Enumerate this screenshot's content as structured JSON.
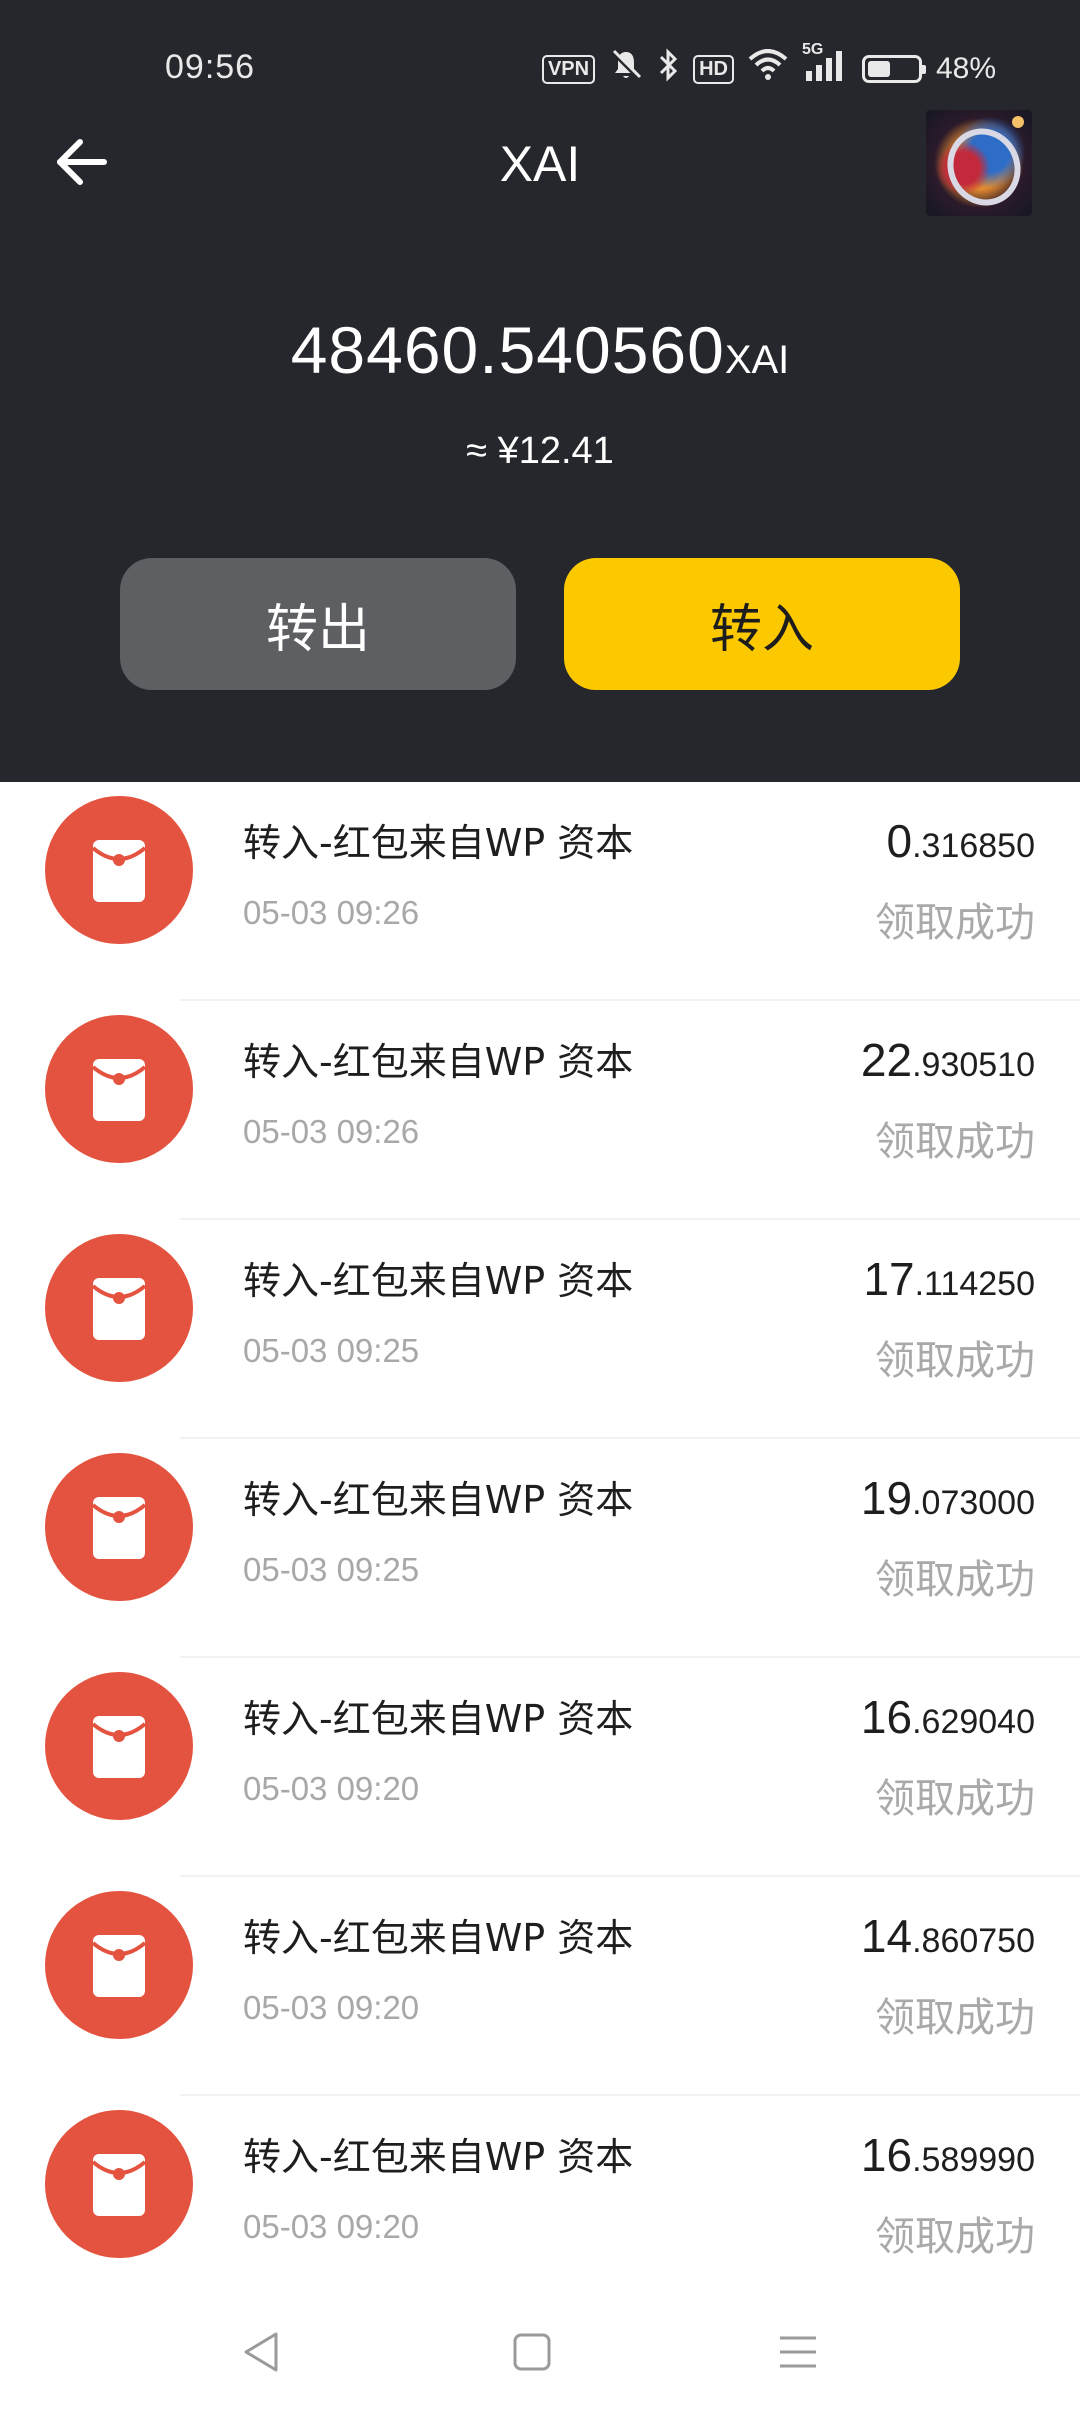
{
  "status_bar": {
    "time": "09:56",
    "vpn": "VPN",
    "hd": "HD",
    "network": "5G",
    "battery": "48%"
  },
  "header": {
    "title": "XAI",
    "balance_amount": "48460.540560",
    "balance_unit": "XAI",
    "fiat_value": "≈ ¥12.41"
  },
  "actions": {
    "transfer_out": "转出",
    "transfer_in": "转入"
  },
  "transactions": [
    {
      "title": "转入-红包来自WP 资本",
      "time": "05-03 09:26",
      "amount_int": "0",
      "amount_dec": ".316850",
      "status": "领取成功"
    },
    {
      "title": "转入-红包来自WP 资本",
      "time": "05-03 09:26",
      "amount_int": "22",
      "amount_dec": ".930510",
      "status": "领取成功"
    },
    {
      "title": "转入-红包来自WP 资本",
      "time": "05-03 09:25",
      "amount_int": "17",
      "amount_dec": ".114250",
      "status": "领取成功"
    },
    {
      "title": "转入-红包来自WP 资本",
      "time": "05-03 09:25",
      "amount_int": "19",
      "amount_dec": ".073000",
      "status": "领取成功"
    },
    {
      "title": "转入-红包来自WP 资本",
      "time": "05-03 09:20",
      "amount_int": "16",
      "amount_dec": ".629040",
      "status": "领取成功"
    },
    {
      "title": "转入-红包来自WP 资本",
      "time": "05-03 09:20",
      "amount_int": "14",
      "amount_dec": ".860750",
      "status": "领取成功"
    },
    {
      "title": "转入-红包来自WP 资本",
      "time": "05-03 09:20",
      "amount_int": "16",
      "amount_dec": ".589990",
      "status": "领取成功"
    }
  ],
  "colors": {
    "header_bg": "#25272c",
    "transfer_out_bg": "#5d5f63",
    "transfer_in_bg": "#fcc900",
    "red_packet": "#e4533f"
  },
  "icons": {
    "back": "arrow-left-icon",
    "red_packet": "red-packet-icon",
    "nav_back": "triangle-back-icon",
    "nav_home": "square-home-icon",
    "nav_menu": "menu-lines-icon"
  }
}
